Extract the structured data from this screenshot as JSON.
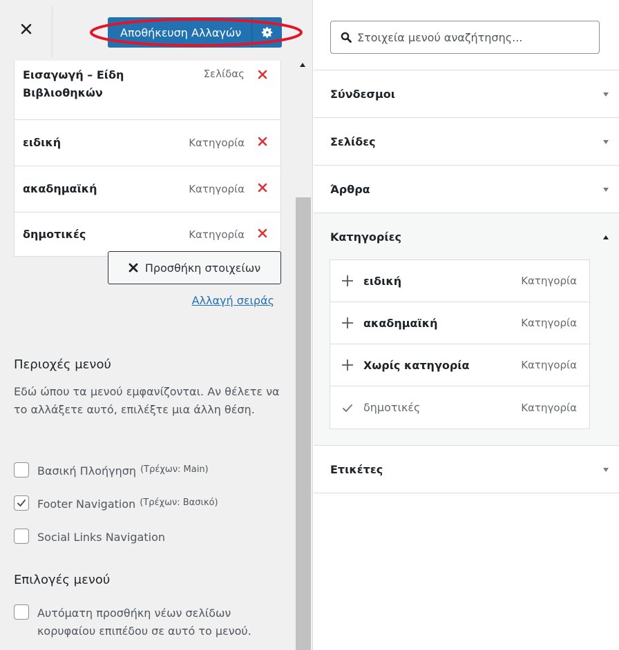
{
  "header": {
    "close_icon": "close-icon",
    "save_label": "Αποθήκευση Αλλαγών",
    "settings_icon": "gear-icon",
    "annotation_color": "#e3152a"
  },
  "menu_items": [
    {
      "title": "Εισαγωγή – Είδη Βιβλιοθηκών",
      "type": "Σελίδας"
    },
    {
      "title": "ειδική",
      "type": "Κατηγορία"
    },
    {
      "title": "ακαδημαϊκή",
      "type": "Κατηγορία"
    },
    {
      "title": "δημοτικές",
      "type": "Κατηγορία"
    }
  ],
  "actions": {
    "add_items_label": "Προσθήκη στοιχείων",
    "reorder_label": "Αλλαγή σειράς"
  },
  "menu_locations": {
    "title": "Περιοχές μενού",
    "description": "Εδώ ώπου τα μενού εμφανίζονται. Αν θέλετε να το αλλάξετε αυτό, επιλέξτε μια άλλη θέση.",
    "options": [
      {
        "label": "Βασική Πλοήγηση",
        "note": "(Τρέχων: Main)",
        "checked": false
      },
      {
        "label": "Footer Navigation",
        "note": "(Τρέχων: Βασικό)",
        "checked": true
      },
      {
        "label": "Social Links Navigation",
        "note": "",
        "checked": false
      }
    ]
  },
  "menu_options": {
    "title": "Επιλογές μενού",
    "auto_add_label": "Αυτόματη προσθήκη νέων σελίδων κορυφαίου επιπέδου σε αυτό το μενού.",
    "auto_add_checked": false
  },
  "search": {
    "placeholder": "Στοιχεία μενού αναζήτησης..."
  },
  "accordion": {
    "links": "Σύνδεσμοι",
    "pages": "Σελίδες",
    "posts": "Άρθρα",
    "categories": "Κατηγορίες",
    "tags": "Ετικέτες"
  },
  "categories": [
    {
      "title": "ειδική",
      "type": "Κατηγορία",
      "added": false
    },
    {
      "title": "ακαδημαϊκή",
      "type": "Κατηγορία",
      "added": false
    },
    {
      "title": "Χωρίς κατηγορία",
      "type": "Κατηγορία",
      "added": false
    },
    {
      "title": "δημοτικές",
      "type": "Κατηγορία",
      "added": true
    }
  ],
  "colors": {
    "primary": "#2271b1",
    "delete": "#d63638",
    "background": "#f0f0f1"
  }
}
